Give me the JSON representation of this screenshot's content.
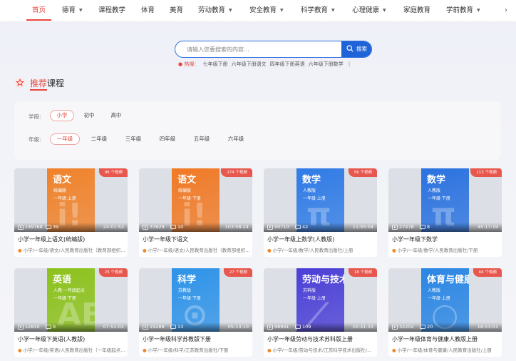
{
  "nav": {
    "items": [
      {
        "label": "首页",
        "caret": false
      },
      {
        "label": "德育",
        "caret": true
      },
      {
        "label": "课程教学",
        "caret": false
      },
      {
        "label": "体育",
        "caret": false
      },
      {
        "label": "美育",
        "caret": false
      },
      {
        "label": "劳动教育",
        "caret": true
      },
      {
        "label": "安全教育",
        "caret": true
      },
      {
        "label": "科学教育",
        "caret": true
      },
      {
        "label": "心理健康",
        "caret": true
      },
      {
        "label": "家庭教育",
        "caret": false
      },
      {
        "label": "学前教育",
        "caret": true
      }
    ],
    "more": "›",
    "active_color": "#e8453c"
  },
  "search": {
    "placeholder": "请输入您要搜索的内容...",
    "button_label": "搜索",
    "hot_label": "热搜：",
    "hot_keywords": [
      "七年级下册",
      "六年级下册语文",
      "四年级下册英语",
      "六年级下册数学"
    ],
    "separator": "|"
  },
  "section": {
    "title_accent": "推荐",
    "title_rest": "课程"
  },
  "filters": {
    "stage_label": "学段:",
    "stages": [
      "小学",
      "初中",
      "高中"
    ],
    "stage_selected": "小学",
    "grade_label": "年级:",
    "grades": [
      "一年级",
      "二年级",
      "三年级",
      "四年级",
      "五年级",
      "六年级"
    ],
    "grade_selected": "一年级"
  },
  "cards": [
    {
      "title": "小学一年级上语文(统编版)",
      "sub": "小学/一年级/语文/人民教育出版社（教育部组织编写）",
      "badge": "96 个视频",
      "views": "149768",
      "comments": "39",
      "duration": "24:01:52",
      "cover_title": "语文",
      "cover_sub1": "统编版",
      "cover_sub2": "一年级·上册",
      "cover_deco": "i!",
      "cover_color": "#f0822a"
    },
    {
      "title": "小学一年级下语文",
      "sub": "小学/一年级/语文/人民教育出版社（教育部组织编写）",
      "badge": "274 个视频",
      "views": "37629",
      "comments": "10",
      "duration": "103:08:24",
      "cover_title": "语文",
      "cover_sub1": "统编版",
      "cover_sub2": "一年级·下册",
      "cover_deco": "i!",
      "cover_color": "#f07a26"
    },
    {
      "title": "小学一年级上数学(人教版)",
      "sub": "小学/一年级/数学/人民教育出版社/上册",
      "badge": "56 个视频",
      "views": "90710",
      "comments": "42",
      "duration": "11:55:04",
      "cover_title": "数学",
      "cover_sub1": "人教版",
      "cover_sub2": "一年级·上册",
      "cover_deco": "π",
      "cover_color": "#2f7be6"
    },
    {
      "title": "小学一年级下数学",
      "sub": "小学/一年级/数学/人民教育出版社/下册",
      "badge": "113 个视频",
      "views": "27478",
      "comments": "8",
      "duration": "45:17:19",
      "cover_title": "数学",
      "cover_sub1": "人教版",
      "cover_sub2": "一年级·下册",
      "cover_deco": "π",
      "cover_color": "#2a72e0"
    },
    {
      "title": "小学一年级下英语(人教版)",
      "sub": "小学/一年级/英语/人民教育出版社（一年级起点）/下册",
      "badge": "25 个视频",
      "views": "12810",
      "comments": "9",
      "duration": "07:51:02",
      "cover_title": "英语",
      "cover_sub1": "人教·一年级起点",
      "cover_sub2": "一年级·下册",
      "cover_deco": "AB",
      "cover_color": "#8cc21c"
    },
    {
      "title": "小学一年级科学苏教版下册",
      "sub": "小学/一年级/科学/江苏教育出版社/下册",
      "badge": "27 个视频",
      "views": "19288",
      "comments": "13",
      "duration": "05:13:10",
      "cover_title": "科学",
      "cover_sub1": "苏教版",
      "cover_sub2": "一年级·下册",
      "cover_deco": "⊙",
      "cover_color": "#2e93e8"
    },
    {
      "title": "小学一年级劳动与技术苏科版上册",
      "sub": "小学/一年级/劳动与技术/江苏科学技术出版社/上册",
      "badge": "18 个视频",
      "views": "98941",
      "comments": "109",
      "duration": "02:41:33",
      "cover_title": "劳动与技术",
      "cover_sub1": "苏科版",
      "cover_sub2": "一年级·上册",
      "cover_deco": "⟋",
      "cover_color": "#4b3fd6"
    },
    {
      "title": "小学一年级体育与健康人教版上册",
      "sub": "小学/一年级/体育与健康/人民教育出版社/上册",
      "badge": "66 个视频",
      "views": "32202",
      "comments": "20",
      "duration": "18:53:51",
      "cover_title": "体育与健康",
      "cover_sub1": "人教版",
      "cover_sub2": "一年级·上册",
      "cover_deco": "○",
      "cover_color": "#2a86e4"
    }
  ]
}
